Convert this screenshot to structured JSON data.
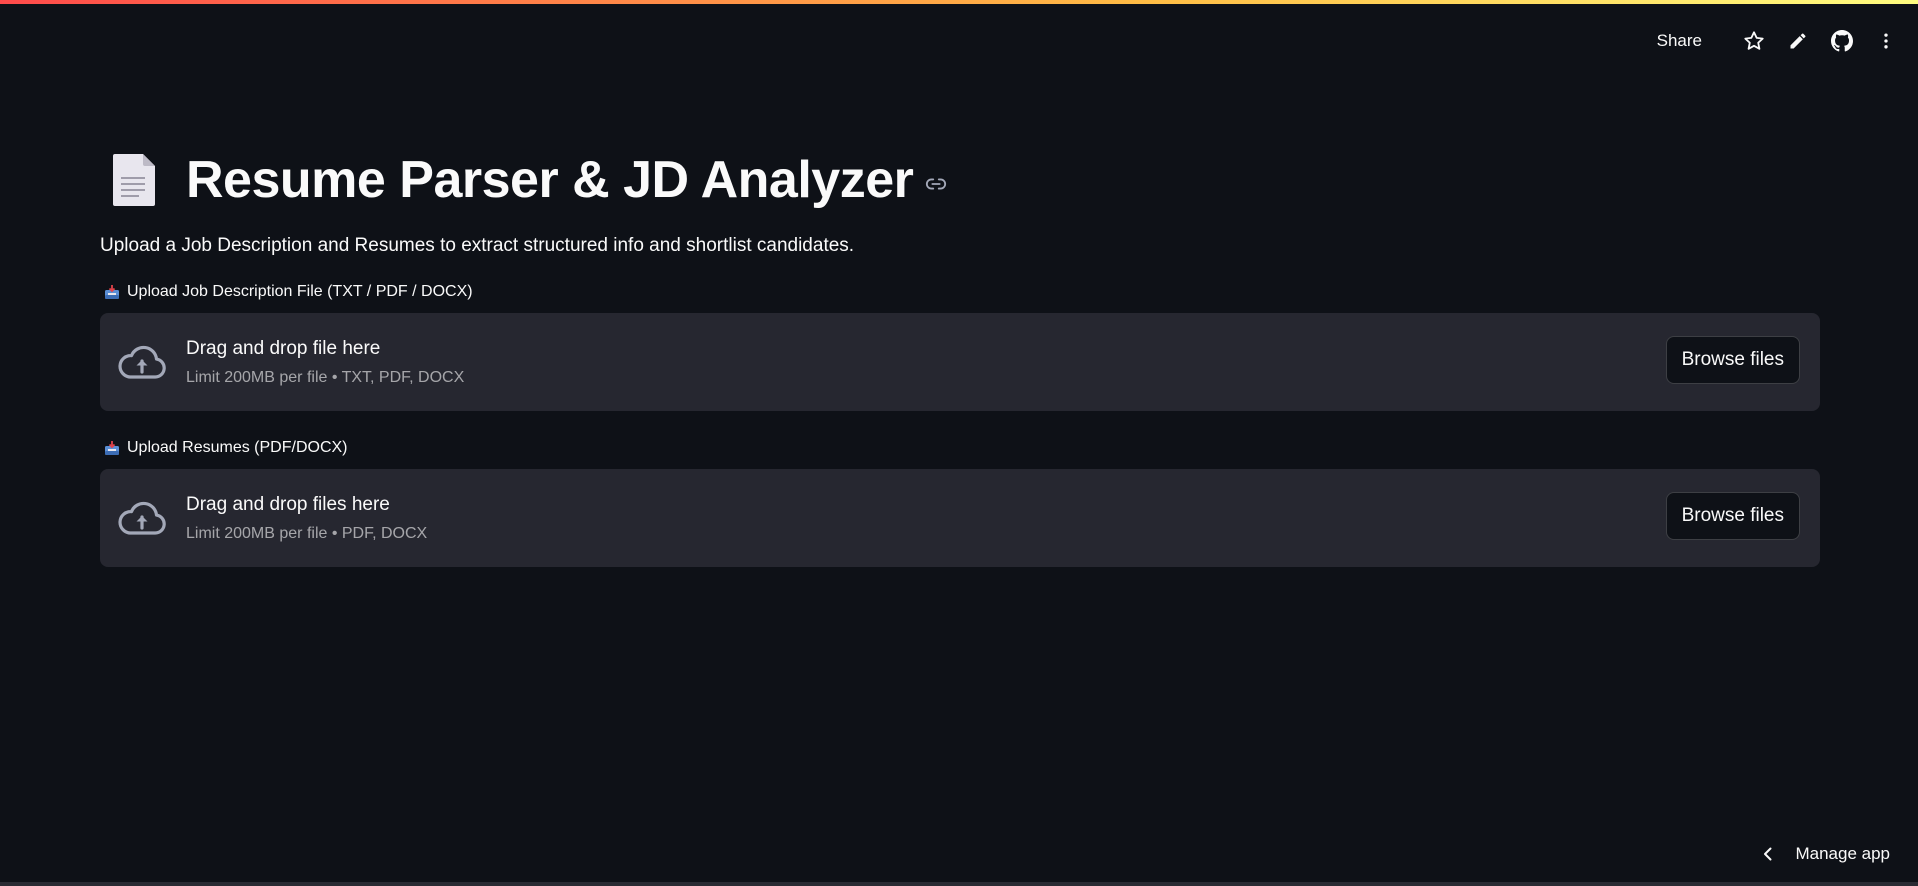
{
  "header": {
    "share_label": "Share",
    "icons": [
      "star-icon",
      "pencil-icon",
      "github-icon",
      "more-vertical-icon"
    ]
  },
  "page": {
    "title": "Resume Parser & JD Analyzer",
    "subtitle": "Upload a Job Description and Resumes to extract structured info and shortlist candidates."
  },
  "uploaders": [
    {
      "label": "Upload Job Description File (TXT / PDF / DOCX)",
      "drop_text": "Drag and drop file here",
      "limit_text": "Limit 200MB per file • TXT, PDF, DOCX",
      "button_label": "Browse files"
    },
    {
      "label": "Upload Resumes (PDF/DOCX)",
      "drop_text": "Drag and drop files here",
      "limit_text": "Limit 200MB per file • PDF, DOCX",
      "button_label": "Browse files"
    }
  ],
  "footer": {
    "manage_label": "Manage app"
  },
  "colors": {
    "background": "#0e1117",
    "dropzone": "#262730",
    "text": "#fafafa"
  }
}
